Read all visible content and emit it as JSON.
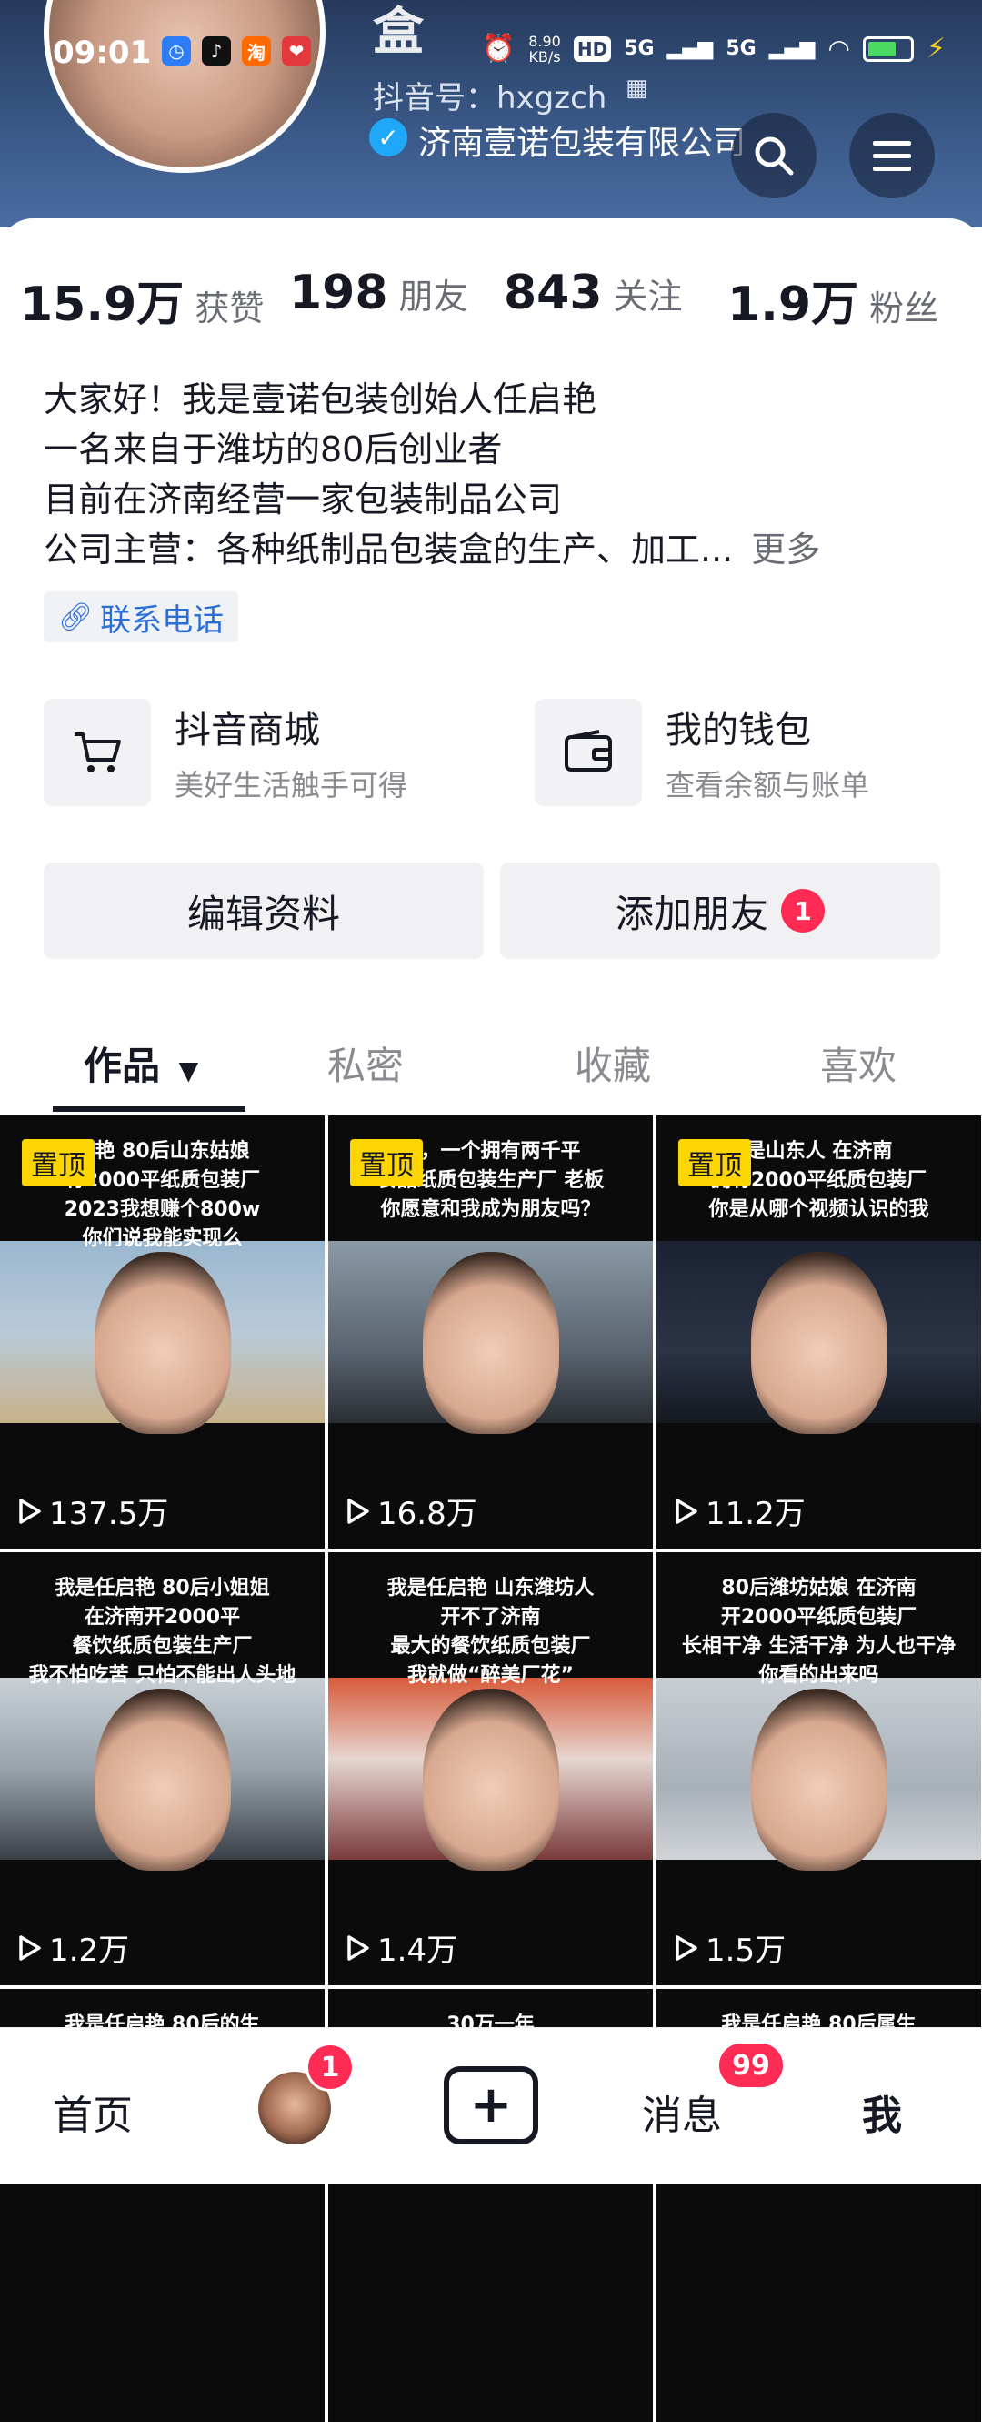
{
  "status_bar": {
    "time": "09:01",
    "net_speed": "8.90",
    "net_unit": "KB/s",
    "hd": "HD",
    "signal1": "5G",
    "signal2": "5G"
  },
  "profile": {
    "name_partial": "盒",
    "douyin_id": "抖音号：hxgzch",
    "company": "济南壹诺包装有限公司"
  },
  "stats": [
    {
      "value": "15.9万",
      "label": "获赞"
    },
    {
      "value": "198",
      "label": "朋友"
    },
    {
      "value": "843",
      "label": "关注"
    },
    {
      "value": "1.9万",
      "label": "粉丝"
    }
  ],
  "bio": {
    "lines": [
      "大家好！我是壹诺包装创始人任启艳",
      "一名来自于潍坊的80后创业者",
      "目前在济南经营一家包装制品公司",
      "公司主营：各种纸制品包装盒的生产、加工..."
    ],
    "more": "更多",
    "phone_label": "联系电话"
  },
  "services": [
    {
      "title": "抖音商城",
      "subtitle": "美好生活触手可得"
    },
    {
      "title": "我的钱包",
      "subtitle": "查看余额与账单"
    }
  ],
  "buttons": {
    "edit_profile": "编辑资料",
    "add_friend": "添加朋友",
    "add_friend_badge": "1"
  },
  "tabs": [
    "作品",
    "私密",
    "收藏",
    "喜欢"
  ],
  "videos": [
    {
      "caption": [
        "启艳 80后山东姑娘",
        "有2000平纸质包装厂",
        "2023我想赚个800w",
        "你们说我能实现么"
      ],
      "views": "137.5万",
      "pinned": "置顶"
    },
    {
      "caption": [
        "南，一个拥有两千平",
        "食品纸质包装生产厂 老板",
        "你愿意和我成为朋友吗？"
      ],
      "views": "16.8万",
      "pinned": "置顶"
    },
    {
      "caption": [
        "是山东人 在济南",
        "拥有2000平纸质包装厂",
        "你是从哪个视频认识的我"
      ],
      "views": "11.2万",
      "pinned": "置顶"
    },
    {
      "caption": [
        "我是任启艳 80后小姐姐",
        "在济南开2000平",
        "餐饮纸质包装生产厂",
        "我不怕吃苦 只怕不能出人头地"
      ],
      "views": "1.2万",
      "pinned": ""
    },
    {
      "caption": [
        "我是任启艳 山东潍坊人",
        "开不了济南",
        "最大的餐饮纸质包装厂",
        "我就做“醉美厂花”"
      ],
      "views": "1.4万",
      "pinned": ""
    },
    {
      "caption": [
        "80后潍坊姑娘 在济南",
        "开2000平纸质包装厂",
        "长相干净 生活干净 为人也干净",
        "你看的出来吗"
      ],
      "views": "1.5万",
      "pinned": ""
    },
    {
      "caption": [
        "我是任启艳 80后的生"
      ],
      "views": "",
      "pinned": ""
    },
    {
      "caption": [
        "30万一年"
      ],
      "views": "",
      "pinned": ""
    },
    {
      "caption": [
        "我是任启艳 80后属生"
      ],
      "views": "",
      "pinned": ""
    }
  ],
  "bottom_nav": {
    "home": "首页",
    "friends_badge": "1",
    "messages": "消息",
    "messages_badge": "99",
    "me": "我"
  },
  "colors": {
    "accent_red": "#fe2c55",
    "pin_yellow": "#fdd500",
    "link_blue": "#2b6fd6",
    "verified_blue": "#20a8f8"
  }
}
